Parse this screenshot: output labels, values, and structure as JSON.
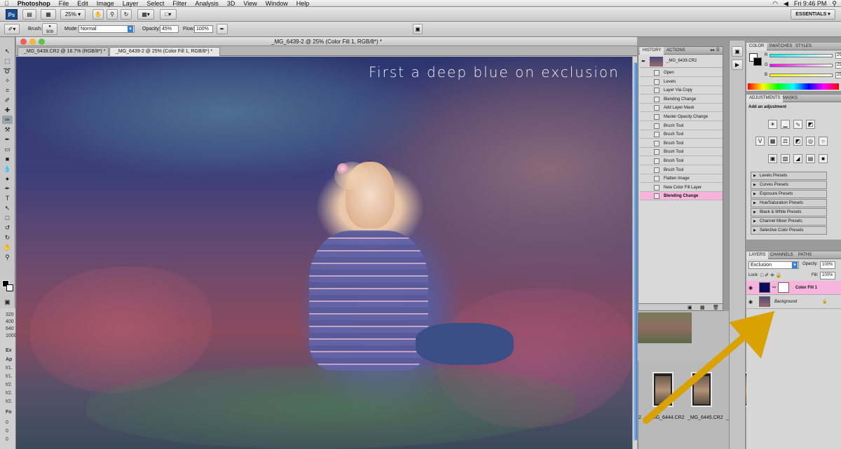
{
  "menubar": {
    "apple": "",
    "app_name": "Photoshop",
    "items": [
      "File",
      "Edit",
      "Image",
      "Layer",
      "Select",
      "Filter",
      "Analysis",
      "3D",
      "View",
      "Window",
      "Help"
    ],
    "clock": "Fri 9:46 PM"
  },
  "appbar": {
    "logo": "Ps",
    "zoom": "25%",
    "workspace": "ESSENTIALS"
  },
  "options": {
    "brush_label": "Brush:",
    "brush_size": "909",
    "mode_label": "Mode:",
    "mode_value": "Normal",
    "opacity_label": "Opacity:",
    "opacity_value": "45%",
    "flow_label": "Flow:",
    "flow_value": "100%"
  },
  "document": {
    "title": "_MG_6439-2 @ 25% (Color Fill 1, RGB/8*) *",
    "tabs": [
      {
        "label": "_MG_6439.CR2 @ 16.7% (RGB/8*) *"
      },
      {
        "label": "_MG_6439-2 @ 25% (Color Fill 1, RGB/8*) *"
      }
    ],
    "caption": "First a deep blue on exclusion"
  },
  "left_strip": [
    "320",
    "400",
    "640",
    "1000",
    "Ex",
    "Ap",
    "f/1.",
    "f/1.",
    "f/2.",
    "f/2.",
    "f/2.",
    "Fo",
    "0",
    "0",
    "0"
  ],
  "history": {
    "tabs": [
      "HISTORY",
      "ACTIONS"
    ],
    "snapshot": "_MG_6439.CR2",
    "items": [
      "Open",
      "Levels",
      "Layer Via Copy",
      "Blending Change",
      "Add Layer Mask",
      "Master Opacity Change",
      "Brush Tool",
      "Brush Tool",
      "Brush Tool",
      "Brush Tool",
      "Brush Tool",
      "Brush Tool",
      "Flatten Image",
      "New Color Fill Layer",
      "Blending Change"
    ],
    "selected_index": 14
  },
  "filmstrip": {
    "labels": [
      "2",
      "_MG_6444.CR2",
      "_MG_6445.CR2",
      "_MG_"
    ]
  },
  "color_panel": {
    "tabs": [
      "COLOR",
      "SWATCHES",
      "STYLES"
    ],
    "r_label": "R",
    "g_label": "G",
    "b_label": "B",
    "r": "253",
    "g": "254",
    "b": "252"
  },
  "adjustments": {
    "tabs": [
      "ADJUSTMENTS",
      "MASKS"
    ],
    "heading": "Add an adjustment",
    "presets": [
      "Levels Presets",
      "Curves Presets",
      "Exposure Presets",
      "Hue/Saturation Presets",
      "Black & White Presets",
      "Channel Mixer Presets",
      "Selective Color Presets"
    ]
  },
  "layers": {
    "tabs": [
      "LAYERS",
      "CHANNELS",
      "PATHS"
    ],
    "blend_mode": "Exclusion",
    "opacity_label": "Opacity:",
    "opacity": "100%",
    "lock_label": "Lock:",
    "fill_label": "Fill:",
    "fill": "100%",
    "items": [
      {
        "name": "Color Fill 1"
      },
      {
        "name": "Background"
      }
    ]
  },
  "colors": {
    "fill_color": "#0a0a5a",
    "highlight": "#f7b4dc",
    "arrow": "#d9a200"
  }
}
